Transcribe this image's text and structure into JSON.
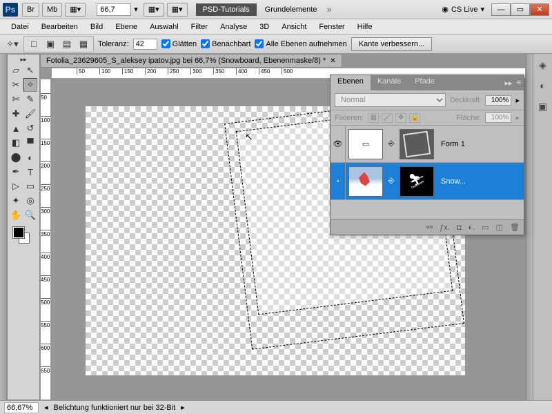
{
  "titlebar": {
    "ps": "Ps",
    "br": "Br",
    "mb": "Mb",
    "zoom": "66,7",
    "workspace_primary": "PSD-Tutorials",
    "workspace_secondary": "Grundelemente",
    "cslive": "CS Live"
  },
  "menu": {
    "datei": "Datei",
    "bearbeiten": "Bearbeiten",
    "bild": "Bild",
    "ebene": "Ebene",
    "auswahl": "Auswahl",
    "filter": "Filter",
    "analyse": "Analyse",
    "dreid": "3D",
    "ansicht": "Ansicht",
    "fenster": "Fenster",
    "hilfe": "Hilfe"
  },
  "options": {
    "toleranz_lbl": "Toleranz:",
    "toleranz_val": "42",
    "glaetten": "Glätten",
    "benachbart": "Benachbart",
    "alle_ebenen": "Alle Ebenen aufnehmen",
    "kante": "Kante verbessern..."
  },
  "document": {
    "tab_title": "Fotolia_23629605_S_aleksey ipatov.jpg bei 66,7% (Snowboard, Ebenenmaske/8) *"
  },
  "ruler_h": [
    "50",
    "100",
    "150",
    "200",
    "250",
    "300",
    "350",
    "400",
    "450",
    "500"
  ],
  "ruler_v": [
    "50",
    "100",
    "150",
    "200",
    "250",
    "300",
    "350",
    "400",
    "450",
    "500",
    "550",
    "600",
    "650"
  ],
  "layers": {
    "tab_ebenen": "Ebenen",
    "tab_kanaele": "Kanäle",
    "tab_pfade": "Pfade",
    "blend_mode": "Normal",
    "deckkraft_lbl": "Deckkraft:",
    "deckkraft_val": "100%",
    "fixieren_lbl": "Fixieren:",
    "flaeche_lbl": "Fläche:",
    "flaeche_val": "100%",
    "layer1_name": "Form 1",
    "layer2_name": "Snow..."
  },
  "status": {
    "zoom": "66,67%",
    "msg": "Belichtung funktioniert nur bei 32-Bit"
  }
}
